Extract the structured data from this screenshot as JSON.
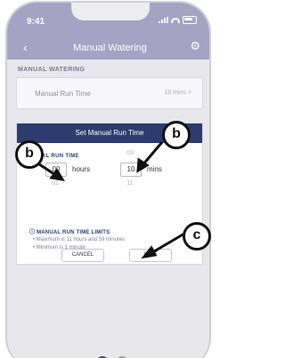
{
  "status": {
    "time": "9:41"
  },
  "header": {
    "title": "Manual Watering",
    "back_icon": "back-arrow-icon",
    "settings_icon": "gear-icon"
  },
  "section": {
    "label": "MANUAL WATERING"
  },
  "row": {
    "label": "Manual Run Time",
    "value": "10 mins",
    "chevron": ">"
  },
  "modal": {
    "title": "Set Manual Run Time",
    "label": "AL RUN TIME",
    "hours": {
      "above": "",
      "value": "00",
      "below": "01",
      "unit": "hours"
    },
    "minutes": {
      "above": "09",
      "value": "10",
      "below": "11",
      "unit": "mins"
    },
    "limits": {
      "title": "MANUAL RUN TIME LIMITS",
      "items": [
        "Maximum is 11 hours and 59 minutes",
        "Minimum is 1 minute"
      ]
    },
    "cancel": "CANCEL",
    "save": "SAVE"
  },
  "callouts": {
    "b1": "b",
    "b2": "b",
    "c": "c"
  },
  "colors": {
    "header": "#a4a3c4",
    "modal_bar": "#2d3c6e",
    "background": "#e7e7ec"
  }
}
